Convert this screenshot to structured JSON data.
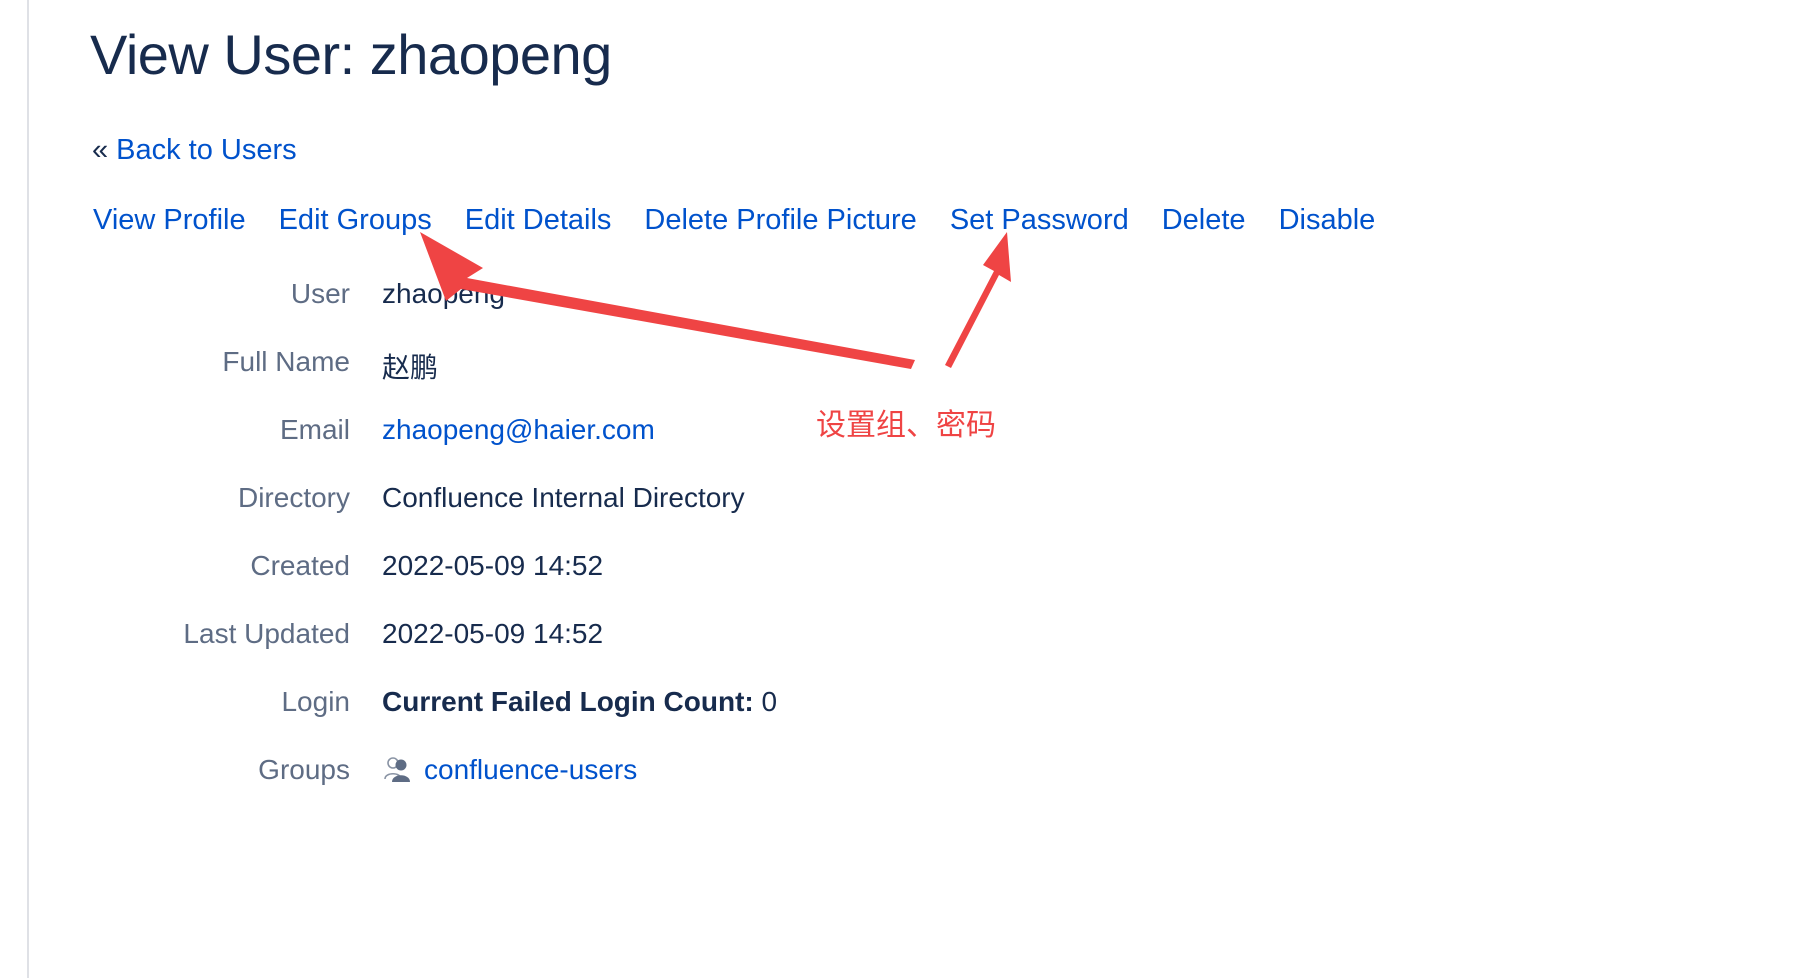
{
  "page": {
    "title": "View User: zhaopeng"
  },
  "nav": {
    "back_prefix": "«",
    "back_label": "Back to Users"
  },
  "actions": [
    {
      "label": "View Profile"
    },
    {
      "label": "Edit Groups"
    },
    {
      "label": "Edit Details"
    },
    {
      "label": "Delete Profile Picture"
    },
    {
      "label": "Set Password"
    },
    {
      "label": "Delete"
    },
    {
      "label": "Disable"
    }
  ],
  "details": {
    "user": {
      "label": "User",
      "value": "zhaopeng"
    },
    "full_name": {
      "label": "Full Name",
      "value": "赵鹏"
    },
    "email": {
      "label": "Email",
      "value": "zhaopeng@haier.com"
    },
    "directory": {
      "label": "Directory",
      "value": "Confluence Internal Directory"
    },
    "created": {
      "label": "Created",
      "value": "2022-05-09 14:52"
    },
    "last_updated": {
      "label": "Last Updated",
      "value": "2022-05-09 14:52"
    },
    "login": {
      "label": "Login",
      "key": "Current Failed Login Count:",
      "value": "0"
    },
    "groups": {
      "label": "Groups",
      "icon": "group-icon",
      "value": "confluence-users"
    }
  },
  "annotation": {
    "text": "设置组、密码",
    "color": "#ef4444"
  },
  "colors": {
    "link": "#0052cc",
    "heading": "#172b4d",
    "label": "#5e6c84"
  }
}
